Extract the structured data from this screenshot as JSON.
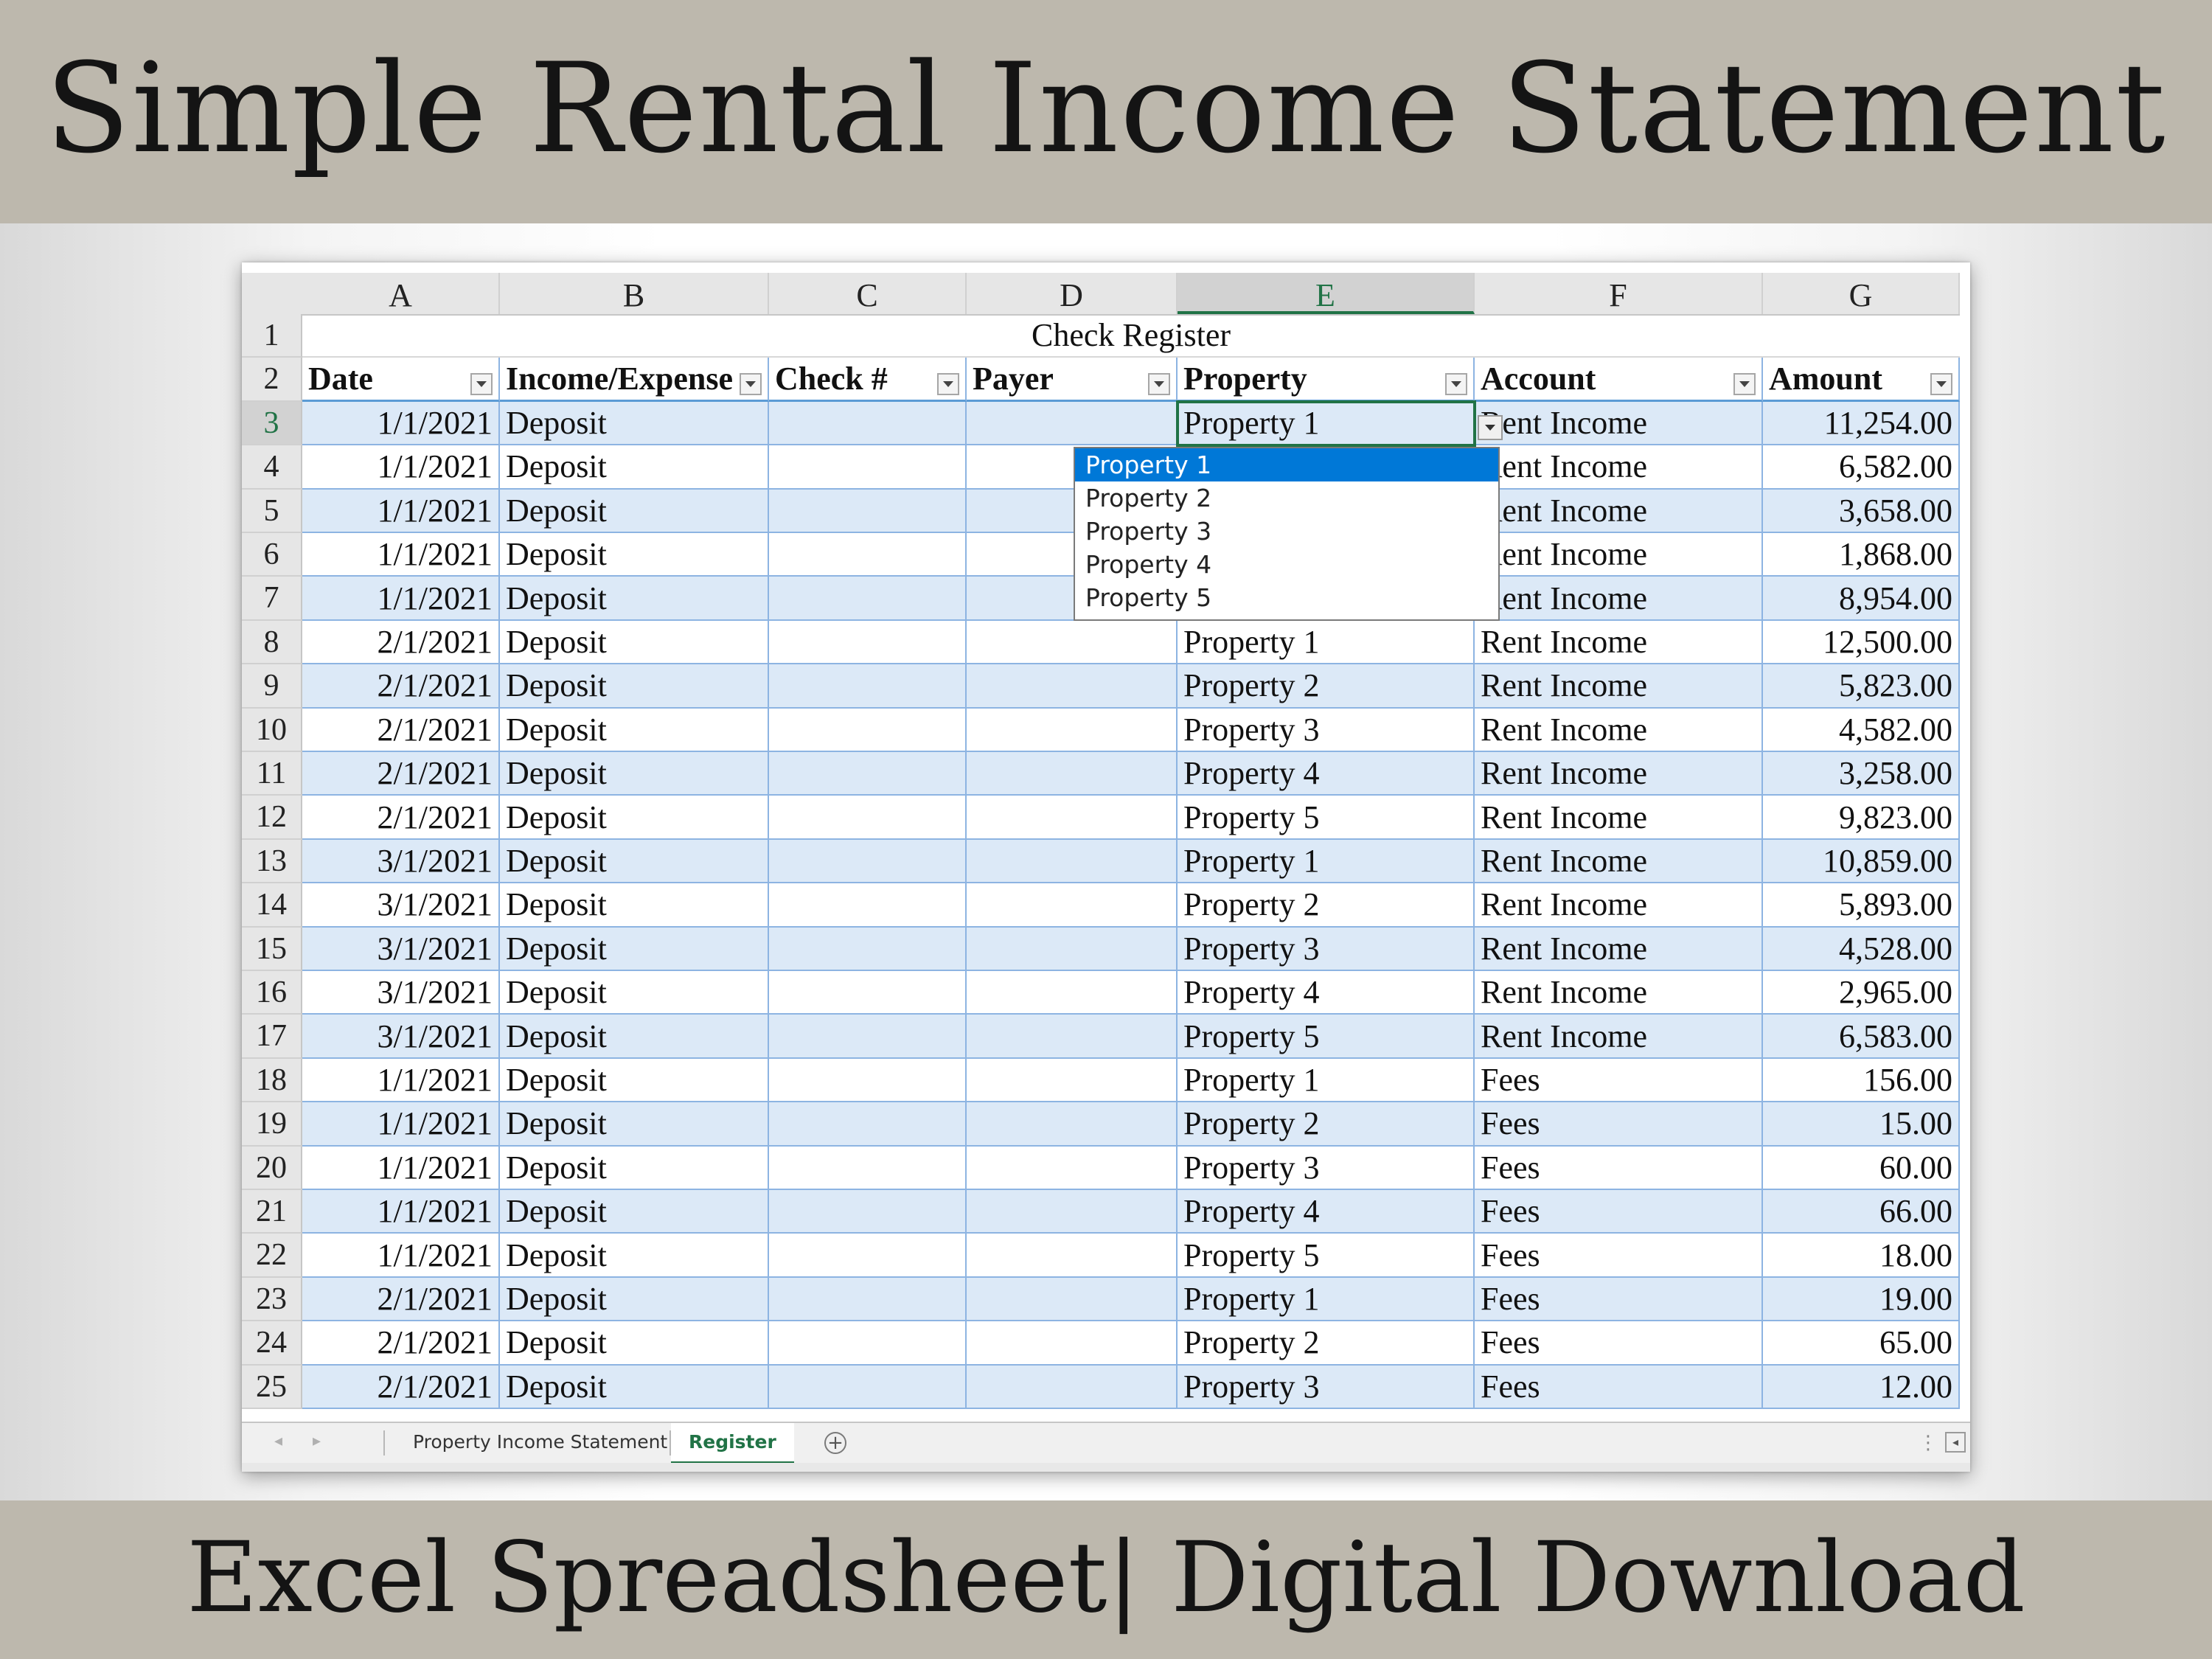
{
  "banner": {
    "top_title": "Simple Rental Income Statement",
    "bottom_title": "Excel Spreadsheet| Digital Download"
  },
  "sheet": {
    "column_letters": [
      "A",
      "B",
      "C",
      "D",
      "E",
      "F",
      "G"
    ],
    "selected_column": "E",
    "title_row_text": "Check Register",
    "headers": [
      "Date",
      "Income/Expense",
      "Check #",
      "Payer",
      "Property",
      "Account",
      "Amount"
    ],
    "rows": [
      {
        "num": "3",
        "date": "1/1/2021",
        "type": "Deposit",
        "check": "",
        "payer": "",
        "property": "Property 1",
        "account": "Rent Income",
        "amount": "11,254.00"
      },
      {
        "num": "4",
        "date": "1/1/2021",
        "type": "Deposit",
        "check": "",
        "payer": "",
        "property": "Property 2",
        "account": "Rent Income",
        "amount": "6,582.00"
      },
      {
        "num": "5",
        "date": "1/1/2021",
        "type": "Deposit",
        "check": "",
        "payer": "",
        "property": "Property 3",
        "account": "Rent Income",
        "amount": "3,658.00"
      },
      {
        "num": "6",
        "date": "1/1/2021",
        "type": "Deposit",
        "check": "",
        "payer": "",
        "property": "Property 4",
        "account": "Rent Income",
        "amount": "1,868.00"
      },
      {
        "num": "7",
        "date": "1/1/2021",
        "type": "Deposit",
        "check": "",
        "payer": "",
        "property": "Property 5",
        "account": "Rent Income",
        "amount": "8,954.00"
      },
      {
        "num": "8",
        "date": "2/1/2021",
        "type": "Deposit",
        "check": "",
        "payer": "",
        "property": "Property 1",
        "account": "Rent Income",
        "amount": "12,500.00"
      },
      {
        "num": "9",
        "date": "2/1/2021",
        "type": "Deposit",
        "check": "",
        "payer": "",
        "property": "Property 2",
        "account": "Rent Income",
        "amount": "5,823.00"
      },
      {
        "num": "10",
        "date": "2/1/2021",
        "type": "Deposit",
        "check": "",
        "payer": "",
        "property": "Property 3",
        "account": "Rent Income",
        "amount": "4,582.00"
      },
      {
        "num": "11",
        "date": "2/1/2021",
        "type": "Deposit",
        "check": "",
        "payer": "",
        "property": "Property 4",
        "account": "Rent Income",
        "amount": "3,258.00"
      },
      {
        "num": "12",
        "date": "2/1/2021",
        "type": "Deposit",
        "check": "",
        "payer": "",
        "property": "Property 5",
        "account": "Rent Income",
        "amount": "9,823.00"
      },
      {
        "num": "13",
        "date": "3/1/2021",
        "type": "Deposit",
        "check": "",
        "payer": "",
        "property": "Property 1",
        "account": "Rent Income",
        "amount": "10,859.00"
      },
      {
        "num": "14",
        "date": "3/1/2021",
        "type": "Deposit",
        "check": "",
        "payer": "",
        "property": "Property 2",
        "account": "Rent Income",
        "amount": "5,893.00"
      },
      {
        "num": "15",
        "date": "3/1/2021",
        "type": "Deposit",
        "check": "",
        "payer": "",
        "property": "Property 3",
        "account": "Rent Income",
        "amount": "4,528.00"
      },
      {
        "num": "16",
        "date": "3/1/2021",
        "type": "Deposit",
        "check": "",
        "payer": "",
        "property": "Property 4",
        "account": "Rent Income",
        "amount": "2,965.00"
      },
      {
        "num": "17",
        "date": "3/1/2021",
        "type": "Deposit",
        "check": "",
        "payer": "",
        "property": "Property 5",
        "account": "Rent Income",
        "amount": "6,583.00"
      },
      {
        "num": "18",
        "date": "1/1/2021",
        "type": "Deposit",
        "check": "",
        "payer": "",
        "property": "Property 1",
        "account": "Fees",
        "amount": "156.00"
      },
      {
        "num": "19",
        "date": "1/1/2021",
        "type": "Deposit",
        "check": "",
        "payer": "",
        "property": "Property 2",
        "account": "Fees",
        "amount": "15.00"
      },
      {
        "num": "20",
        "date": "1/1/2021",
        "type": "Deposit",
        "check": "",
        "payer": "",
        "property": "Property 3",
        "account": "Fees",
        "amount": "60.00"
      },
      {
        "num": "21",
        "date": "1/1/2021",
        "type": "Deposit",
        "check": "",
        "payer": "",
        "property": "Property 4",
        "account": "Fees",
        "amount": "66.00"
      },
      {
        "num": "22",
        "date": "1/1/2021",
        "type": "Deposit",
        "check": "",
        "payer": "",
        "property": "Property 5",
        "account": "Fees",
        "amount": "18.00"
      },
      {
        "num": "23",
        "date": "2/1/2021",
        "type": "Deposit",
        "check": "",
        "payer": "",
        "property": "Property 1",
        "account": "Fees",
        "amount": "19.00"
      },
      {
        "num": "24",
        "date": "2/1/2021",
        "type": "Deposit",
        "check": "",
        "payer": "",
        "property": "Property 2",
        "account": "Fees",
        "amount": "65.00"
      },
      {
        "num": "25",
        "date": "2/1/2021",
        "type": "Deposit",
        "check": "",
        "payer": "",
        "property": "Property 3",
        "account": "Fees",
        "amount": "12.00"
      }
    ],
    "dropdown": {
      "selected": "Property 1",
      "options": [
        "Property 1",
        "Property 2",
        "Property 3",
        "Property 4",
        "Property 5"
      ]
    },
    "tabs": [
      {
        "label": "Property Income Statement",
        "active": false
      },
      {
        "label": "Register",
        "active": true
      }
    ],
    "add_sheet_symbol": "+",
    "more_symbol": "⋮",
    "accent_color": "#217346",
    "band_color": "#dce9f7",
    "highlight_color": "#0078d7"
  }
}
